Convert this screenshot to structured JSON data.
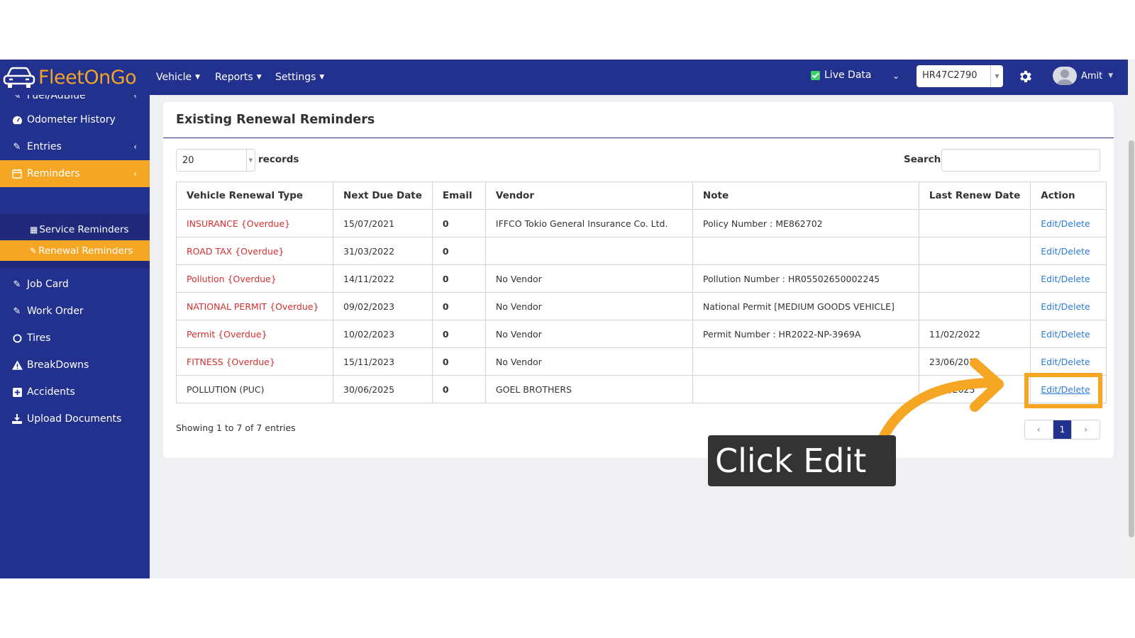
{
  "app": {
    "brand_part1": "Fleet",
    "brand_part2": "On",
    "brand_part3": "Go",
    "brand_color": "#f2a42a",
    "primary_color": "#23318e",
    "accent_color": "#f5a623"
  },
  "topnav": {
    "menus": [
      "Vehicle",
      "Reports",
      "Settings"
    ],
    "live_data_label": "Live Data",
    "live_data_checked": true,
    "vehicle_select_value": "HR47C2790",
    "user_name": "Amit"
  },
  "sidebar": {
    "items": [
      {
        "label": "Fuel/AdBlue",
        "icon": "fuel-icon"
      },
      {
        "label": "Odometer History",
        "icon": "tachometer-icon"
      },
      {
        "label": "Entries",
        "icon": "edit-icon"
      },
      {
        "label": "Reminders",
        "icon": "calendar-icon"
      },
      {
        "label": "Job Card",
        "icon": "edit-icon"
      },
      {
        "label": "Work Order",
        "icon": "edit-icon"
      },
      {
        "label": "Tires",
        "icon": "circle-icon"
      },
      {
        "label": "BreakDowns",
        "icon": "warning-icon"
      },
      {
        "label": "Accidents",
        "icon": "plus-square-icon"
      },
      {
        "label": "Upload Documents",
        "icon": "download-icon"
      }
    ],
    "sub_items": [
      {
        "label": "Service Reminders",
        "icon": "calendar-icon"
      },
      {
        "label": "Renewal Reminders",
        "icon": "edit-icon"
      }
    ]
  },
  "main": {
    "title": "Existing Renewal Reminders",
    "length_value": "20",
    "length_label": "records",
    "search_label": "Search:",
    "search_value": "",
    "columns": [
      "Vehicle Renewal Type",
      "Next Due Date",
      "Email",
      "Vendor",
      "Note",
      "Last Renew Date",
      "Action"
    ],
    "rows": [
      {
        "type": "INSURANCE {Overdue}",
        "overdue": true,
        "due": "15/07/2021",
        "email": "0",
        "vendor": "IFFCO Tokio General Insurance Co. Ltd.",
        "note": "Policy Number : ME862702",
        "last": "",
        "action": "Edit/Delete"
      },
      {
        "type": "ROAD TAX {Overdue}",
        "overdue": true,
        "due": "31/03/2022",
        "email": "0",
        "vendor": "",
        "note": "",
        "last": "",
        "action": "Edit/Delete"
      },
      {
        "type": "Pollution {Overdue}",
        "overdue": true,
        "due": "14/11/2022",
        "email": "0",
        "vendor": "No Vendor",
        "note": "Pollution Number : HR05502650002245",
        "last": "",
        "action": "Edit/Delete"
      },
      {
        "type": "NATIONAL PERMIT {Overdue}",
        "overdue": true,
        "due": "09/02/2023",
        "email": "0",
        "vendor": "No Vendor",
        "note": "National Permit [MEDIUM GOODS VEHICLE]",
        "last": "",
        "action": "Edit/Delete"
      },
      {
        "type": "Permit {Overdue}",
        "overdue": true,
        "due": "10/02/2023",
        "email": "0",
        "vendor": "No Vendor",
        "note": "Permit Number : HR2022-NP-3969A",
        "last": "11/02/2022",
        "action": "Edit/Delete"
      },
      {
        "type": "FITNESS {Overdue}",
        "overdue": true,
        "due": "15/11/2023",
        "email": "0",
        "vendor": "No Vendor",
        "note": "",
        "last": "23/06/201",
        "action": "Edit/Delete"
      },
      {
        "type": "POLLUTION (PUC)",
        "overdue": false,
        "due": "30/06/2025",
        "email": "0",
        "vendor": "GOEL BROTHERS",
        "note": "",
        "last": "…/2025",
        "action": "Edit/Delete"
      }
    ],
    "info_text": "Showing 1 to 7 of 7 entries",
    "pager": {
      "prev": "‹",
      "current": "1",
      "next": "›"
    }
  },
  "annotation": {
    "callout_text": "Click Edit",
    "color": "#f5a623"
  }
}
